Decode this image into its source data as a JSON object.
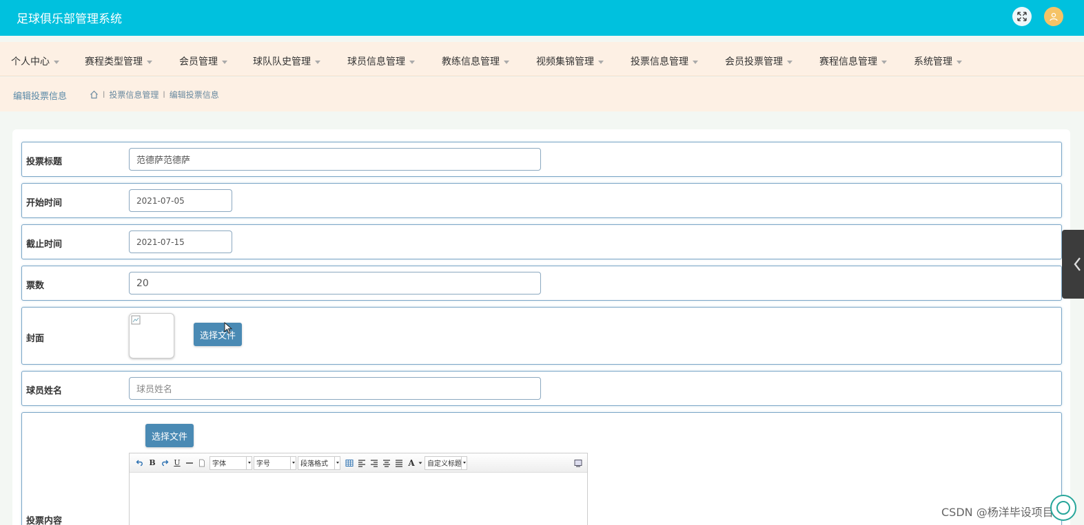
{
  "app": {
    "title": "足球俱乐部管理系统"
  },
  "nav": {
    "items": [
      {
        "label": "个人中心"
      },
      {
        "label": "赛程类型管理"
      },
      {
        "label": "会员管理"
      },
      {
        "label": "球队队史管理"
      },
      {
        "label": "球员信息管理"
      },
      {
        "label": "教练信息管理"
      },
      {
        "label": "视频集锦管理"
      },
      {
        "label": "投票信息管理"
      },
      {
        "label": "会员投票管理"
      },
      {
        "label": "赛程信息管理"
      },
      {
        "label": "系统管理"
      }
    ]
  },
  "breadcrumb": {
    "page_title": "编辑投票信息",
    "items": [
      "投票信息管理",
      "编辑投票信息"
    ],
    "separator": "l"
  },
  "form": {
    "title": {
      "label": "投票标题",
      "value": "范德萨范德萨"
    },
    "start": {
      "label": "开始时间",
      "value": "2021-07-05"
    },
    "end": {
      "label": "截止时间",
      "value": "2021-07-15"
    },
    "votes": {
      "label": "票数",
      "value": "20"
    },
    "cover": {
      "label": "封面",
      "button": "选择文件"
    },
    "player": {
      "label": "球员姓名",
      "placeholder": "球员姓名"
    },
    "content": {
      "label": "投票内容",
      "button": "选择文件",
      "toolbar": {
        "font": "字体",
        "size": "字号",
        "paragraph": "段落格式",
        "custom": "自定义标题",
        "bold": "B",
        "underline": "U",
        "font_color": "A"
      }
    }
  },
  "watermark": "CSDN @杨洋毕设项目",
  "colors": {
    "header": "#00c1de",
    "nav_bg": "#fdf0e4",
    "button": "#4a8ab4",
    "row_border": "#7aa6c7"
  }
}
